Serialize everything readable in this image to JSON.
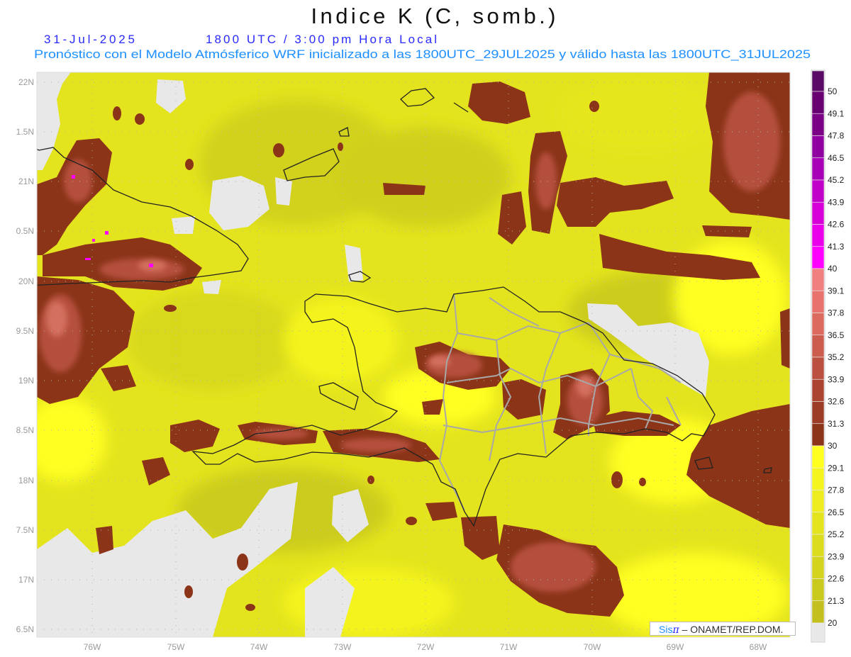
{
  "header": {
    "title": "Indice K (C, somb.)",
    "date": "31-Jul-2025",
    "time": "1800 UTC / 3:00 pm Hora Local",
    "subtitle": "Pronóstico con el Modelo Atmósferico WRF inicializado a las 1800UTC_29JUL2025 y válido hasta las  1800UTC_31JUL2025",
    "title_color": "#111111",
    "date_color": "#2a2aff",
    "subtitle_color": "#1e90ff"
  },
  "map": {
    "latitude_labels": [
      "22N",
      "1.5N",
      "21N",
      "0.5N",
      "20N",
      "9.5N",
      "19N",
      "8.5N",
      "18N",
      "7.5N",
      "17N",
      "6.5N"
    ],
    "longitude_labels": [
      "76W",
      "75W",
      "74W",
      "73W",
      "72W",
      "71W",
      "70W",
      "69W",
      "68W"
    ],
    "field": "Indice K",
    "units": "C"
  },
  "colorbar": {
    "labels": [
      "50",
      "49.1",
      "47.8",
      "46.5",
      "45.2",
      "43.9",
      "42.6",
      "41.3",
      "40",
      "39.1",
      "37.8",
      "36.5",
      "35.2",
      "33.9",
      "32.6",
      "31.3",
      "30",
      "29.1",
      "27.8",
      "26.5",
      "25.2",
      "23.9",
      "22.6",
      "21.3",
      "20"
    ],
    "colors": [
      "#5a0a64",
      "#680072",
      "#7a0086",
      "#9000a0",
      "#a800b6",
      "#c000c8",
      "#d800d8",
      "#ea00ea",
      "#ff00ff",
      "#f08080",
      "#e8736c",
      "#dc6a5e",
      "#cc5c4e",
      "#bb5040",
      "#ab4532",
      "#9c3c26",
      "#8b3418",
      "#ffff20",
      "#f4f41e",
      "#ecec1e",
      "#e4e41e",
      "#dcdc1e",
      "#d4d41e",
      "#caca1e",
      "#c2bf1e",
      "#e8e8e8"
    ]
  },
  "credit": {
    "sis": "Sis",
    "pi": "π",
    "org": " –  ONAMET/REP.DOM."
  }
}
